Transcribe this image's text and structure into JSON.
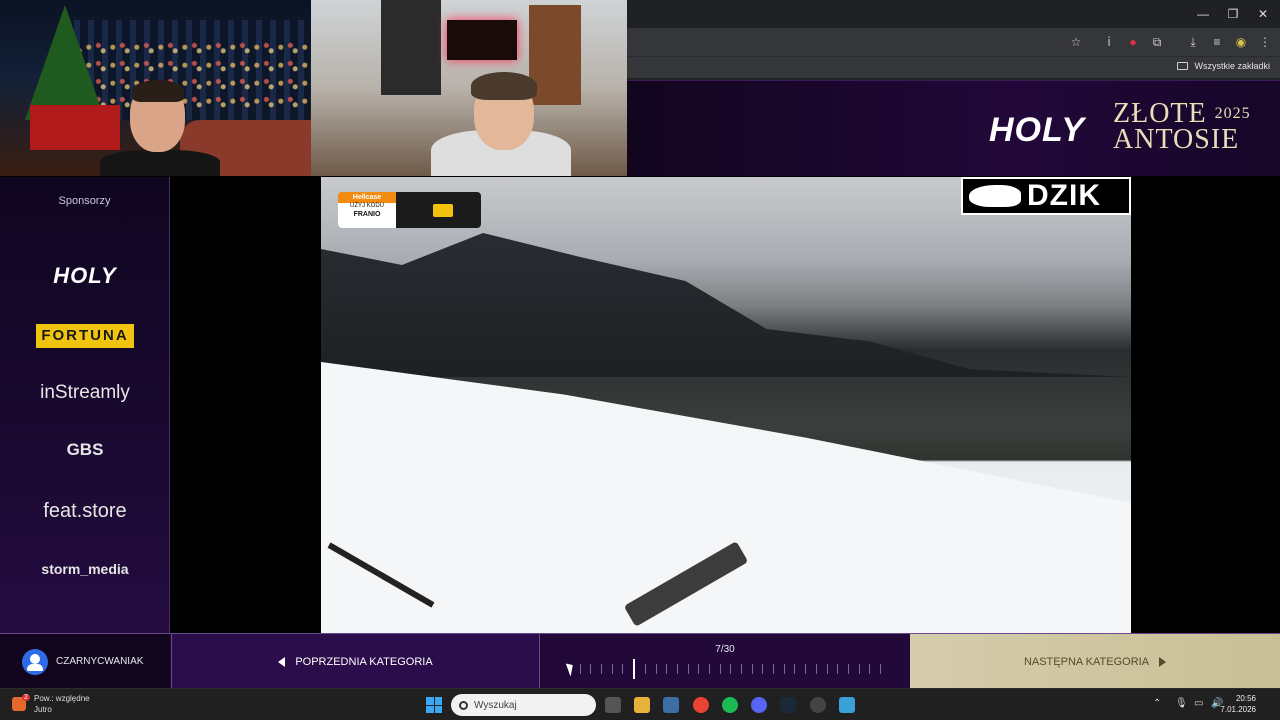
{
  "browser": {
    "window_controls": {
      "minimize": "—",
      "restore": "❐",
      "close": "✕"
    },
    "toolbar_icons": [
      "star-icon",
      "extension-icon",
      "record-icon",
      "puzzle-icon",
      "download-icon",
      "reading-list-icon",
      "profile-icon",
      "menu-icon"
    ],
    "bookmarks_label": "Wszystkie zakładki"
  },
  "banner": {
    "brand": "HOLY",
    "event_line1": "ZŁOTE",
    "event_line2": "ANTOSIE",
    "year": "2025"
  },
  "sidebar": {
    "title": "Sponsorzy",
    "sponsors": [
      "HOLY",
      "FORTUNA",
      "inStreamly",
      "GBS",
      "feat.store",
      "storm_media"
    ]
  },
  "overlay": {
    "hellcase_brand": "Hellcase",
    "hellcase_line": "UŻYJ KODU",
    "hellcase_code": "FRANIO",
    "dzik": "DZIK"
  },
  "footer": {
    "username": "CZARNYCWANIAK",
    "prev_label": "POPRZEDNIA KATEGORIA",
    "progress_label": "7/30",
    "progress_current": 7,
    "progress_total": 30,
    "next_label": "NASTĘPNA KATEGORIA"
  },
  "taskbar": {
    "weather_title": "Pow.: względne",
    "weather_sub": "Jutro",
    "weather_badge": "2",
    "search_placeholder": "Wyszukaj",
    "time": "20:56",
    "date": "7.01.2026",
    "colors": {
      "start": "#3ba7f4",
      "chrome": "#ea4335",
      "spotify": "#1db954",
      "discord": "#5865f2",
      "steam": "#1b2838"
    }
  }
}
